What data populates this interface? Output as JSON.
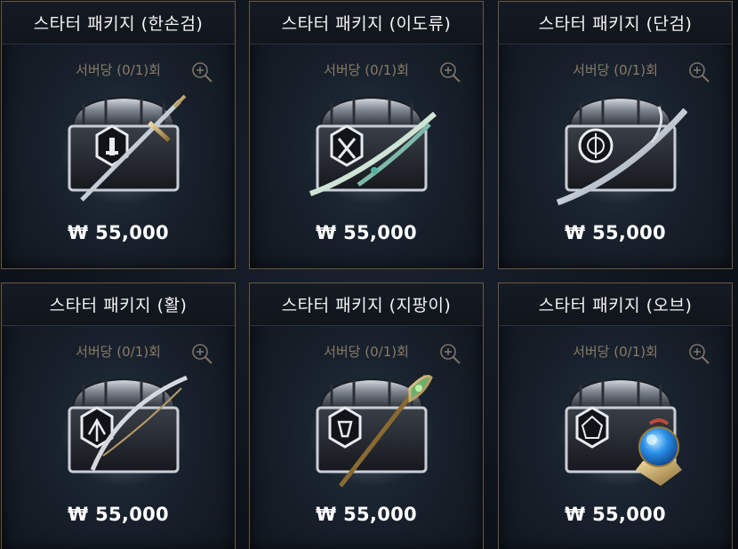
{
  "packages": [
    {
      "title": "스타터 패키지 (한손검)",
      "limit": "서버당 (0/1)회",
      "price": "₩ 55,000",
      "item_icon": "sword-icon"
    },
    {
      "title": "스타터 패키지 (이도류)",
      "limit": "서버당 (0/1)회",
      "price": "₩ 55,000",
      "item_icon": "dual-blades-icon"
    },
    {
      "title": "스타터 패키지 (단검)",
      "limit": "서버당 (0/1)회",
      "price": "₩ 55,000",
      "item_icon": "dagger-icon"
    },
    {
      "title": "스타터 패키지 (활)",
      "limit": "서버당 (0/1)회",
      "price": "₩ 55,000",
      "item_icon": "bow-icon"
    },
    {
      "title": "스타터 패키지 (지팡이)",
      "limit": "서버당 (0/1)회",
      "price": "₩ 55,000",
      "item_icon": "staff-icon"
    },
    {
      "title": "스타터 패키지 (오브)",
      "limit": "서버당 (0/1)회",
      "price": "₩ 55,000",
      "item_icon": "orb-icon"
    }
  ],
  "colors": {
    "border": "#6b5840",
    "limit_text": "#8a7a66",
    "price_text": "#ffffff",
    "orb_blue": "#2a8fe8"
  }
}
